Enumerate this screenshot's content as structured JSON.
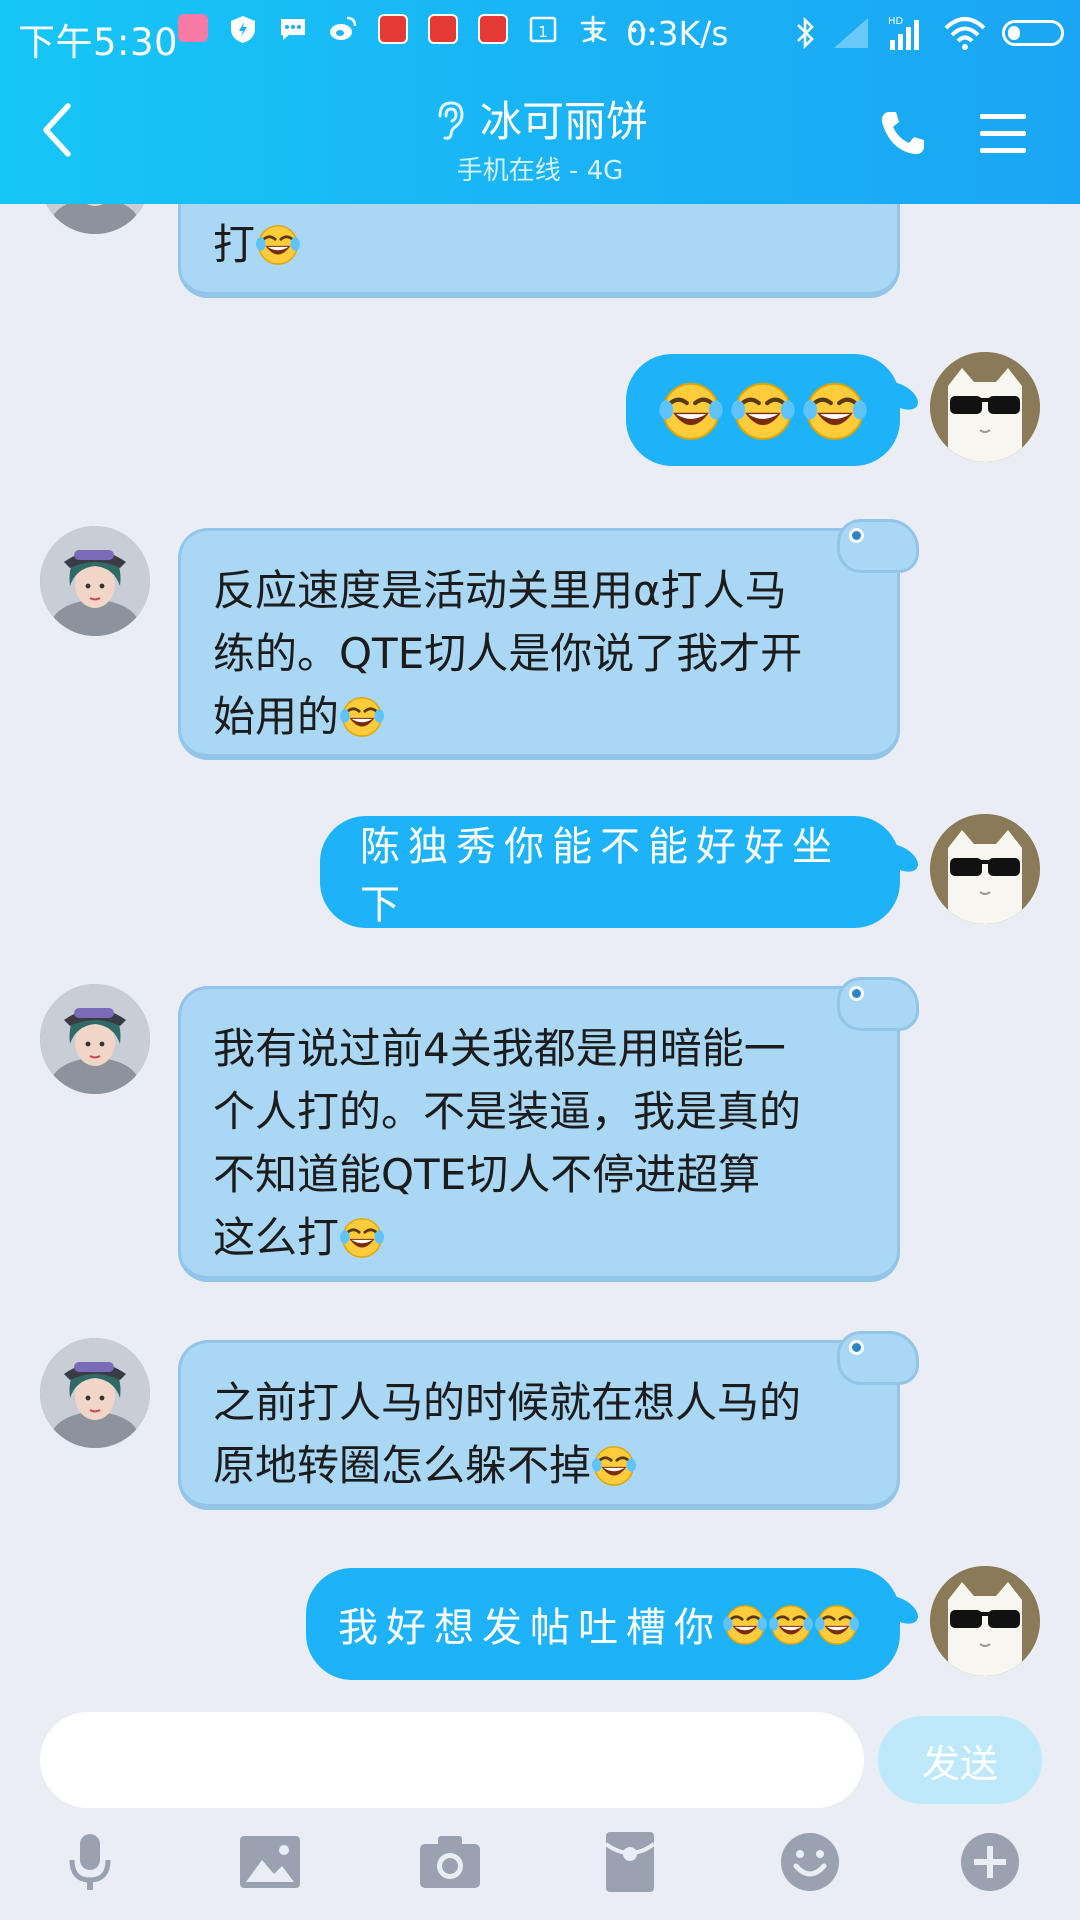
{
  "status_bar": {
    "time": "下午5:30",
    "net_speed": "0.3K/s",
    "network_type": "HD",
    "app_icons": [
      "LaLa",
      "shield",
      "messages",
      "weibo",
      "red-app",
      "red-app",
      "red-app",
      "calendar-1",
      "alipay",
      "more"
    ]
  },
  "header": {
    "title": "冰可丽饼",
    "subtitle": "手机在线 - 4G",
    "back_icon": "chevron-left-icon",
    "call_icon": "phone-icon",
    "menu_icon": "menu-icon"
  },
  "messages": [
    {
      "side": "in",
      "text": "打",
      "emojis": 1
    },
    {
      "side": "out",
      "text": "",
      "emojis": 3
    },
    {
      "side": "in",
      "lines": [
        "反应速度是活动关里用α打人马",
        "练的。QTE切人是你说了我才开",
        "始用的"
      ],
      "emojis": 1
    },
    {
      "side": "out",
      "text": "陈独秀你能不能好好坐下",
      "emojis": 0
    },
    {
      "side": "in",
      "lines": [
        "我有说过前4关我都是用暗能一",
        "个人打的。不是装逼，我是真的",
        "不知道能QTE切人不停进超算",
        "这么打"
      ],
      "emojis": 1
    },
    {
      "side": "in",
      "lines": [
        "之前打人马的时候就在想人马的",
        "原地转圈怎么躲不掉"
      ],
      "emojis": 1
    },
    {
      "side": "out",
      "text": "我好想发帖吐槽你",
      "emojis": 3
    }
  ],
  "composer": {
    "placeholder": "",
    "send_label": "发送"
  },
  "toolbar": [
    "mic-icon",
    "image-icon",
    "camera-icon",
    "red-packet-icon",
    "emoji-icon",
    "plus-icon"
  ],
  "colors": {
    "header": "#1ab1f5",
    "bubble_in": "#a9d7f4",
    "bubble_out": "#1eb3f8",
    "background": "#eaedf4",
    "toolbar_icon": "#9aa2b2"
  }
}
